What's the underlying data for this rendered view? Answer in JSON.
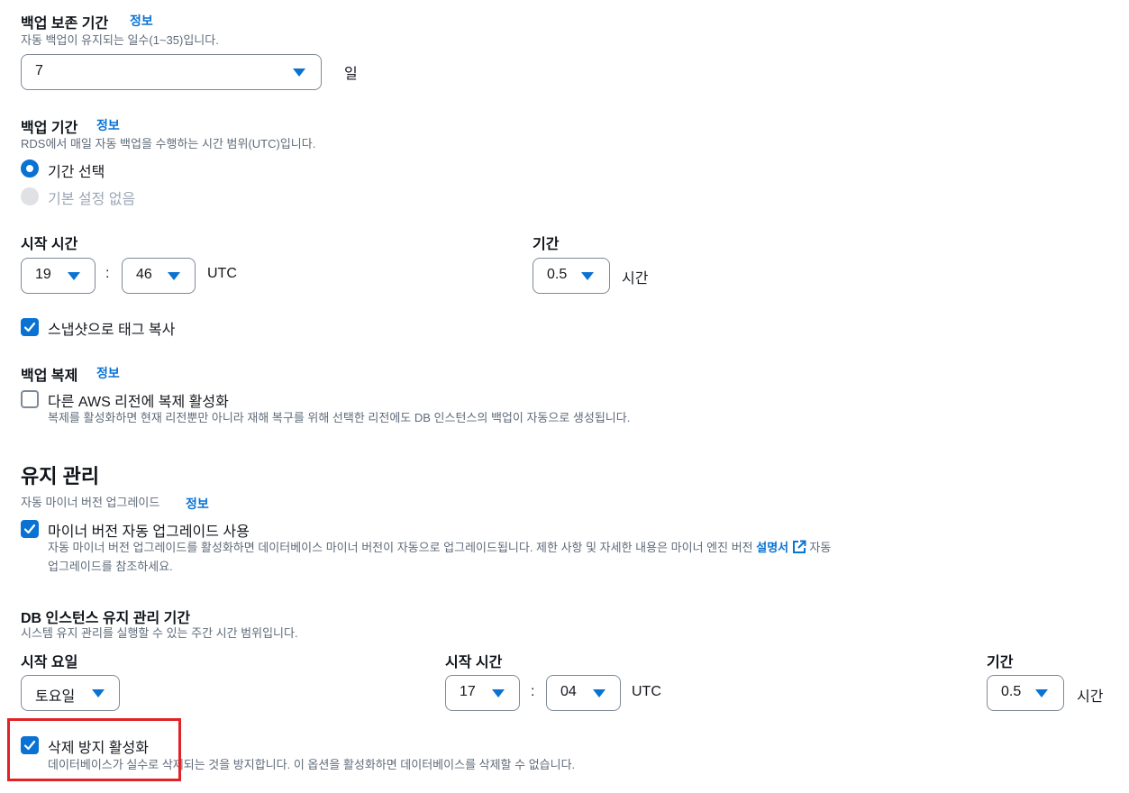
{
  "backup_retention": {
    "label": "백업 보존 기간",
    "info": "정보",
    "description": "자동 백업이 유지되는 일수(1~35)입니다.",
    "value": "7",
    "unit": "일"
  },
  "backup_window": {
    "label": "백업 기간",
    "info": "정보",
    "description": "RDS에서 매일 자동 백업을 수행하는 시간 범위(UTC)입니다.",
    "option_select": "기간 선택",
    "option_none": "기본 설정 없음",
    "start_label": "시작 시간",
    "start_hour": "19",
    "separator": ":",
    "start_minute": "46",
    "timezone": "UTC",
    "duration_label": "기간",
    "duration_value": "0.5",
    "duration_unit": "시간"
  },
  "copy_tags": {
    "label": "스냅샷으로 태그 복사",
    "checked": true
  },
  "backup_replication": {
    "label": "백업 복제",
    "info": "정보",
    "checkbox_label": "다른 AWS 리전에 복제 활성화",
    "checked": false,
    "description": "복제를 활성화하면 현재 리전뿐만 아니라 재해 복구를 위해 선택한 리전에도 DB 인스턴스의 백업이 자동으로 생성됩니다."
  },
  "maintenance": {
    "heading": "유지 관리",
    "auto_minor_label": "자동 마이너 버전 업그레이드",
    "info": "정보",
    "auto_minor_checkbox": "마이너 버전 자동 업그레이드 사용",
    "auto_minor_checked": true,
    "auto_minor_desc_1": "자동 마이너 버전 업그레이드를 활성화하면 데이터베이스 마이너 버전이 자동으로 업그레이드됩니다. 제한 사항 및 자세한 내용은 마이너 엔진 버전",
    "auto_minor_link": "설명서",
    "auto_minor_desc_2": "자동",
    "auto_minor_desc_3": "업그레이드를 참조하세요."
  },
  "maintenance_window": {
    "label": "DB 인스턴스 유지 관리 기간",
    "description": "시스템 유지 관리를 실행할 수 있는 주간 시간 범위입니다.",
    "start_day_label": "시작 요일",
    "start_day": "토요일",
    "start_time_label": "시작 시간",
    "start_hour": "17",
    "separator": ":",
    "start_minute": "04",
    "timezone": "UTC",
    "duration_label": "기간",
    "duration_value": "0.5",
    "duration_unit": "시간"
  },
  "deletion_protection": {
    "label": "삭제 방지 활성화",
    "checked": true,
    "description": "데이터베이스가 실수로 삭제되는 것을 방지합니다. 이 옵션을 활성화하면 데이터베이스를 삭제할 수 없습니다."
  },
  "colors": {
    "accent": "#0972d3",
    "highlight": "#e22226",
    "text": "#16191f",
    "muted": "#5f6b7a",
    "border": "#7d8998"
  }
}
